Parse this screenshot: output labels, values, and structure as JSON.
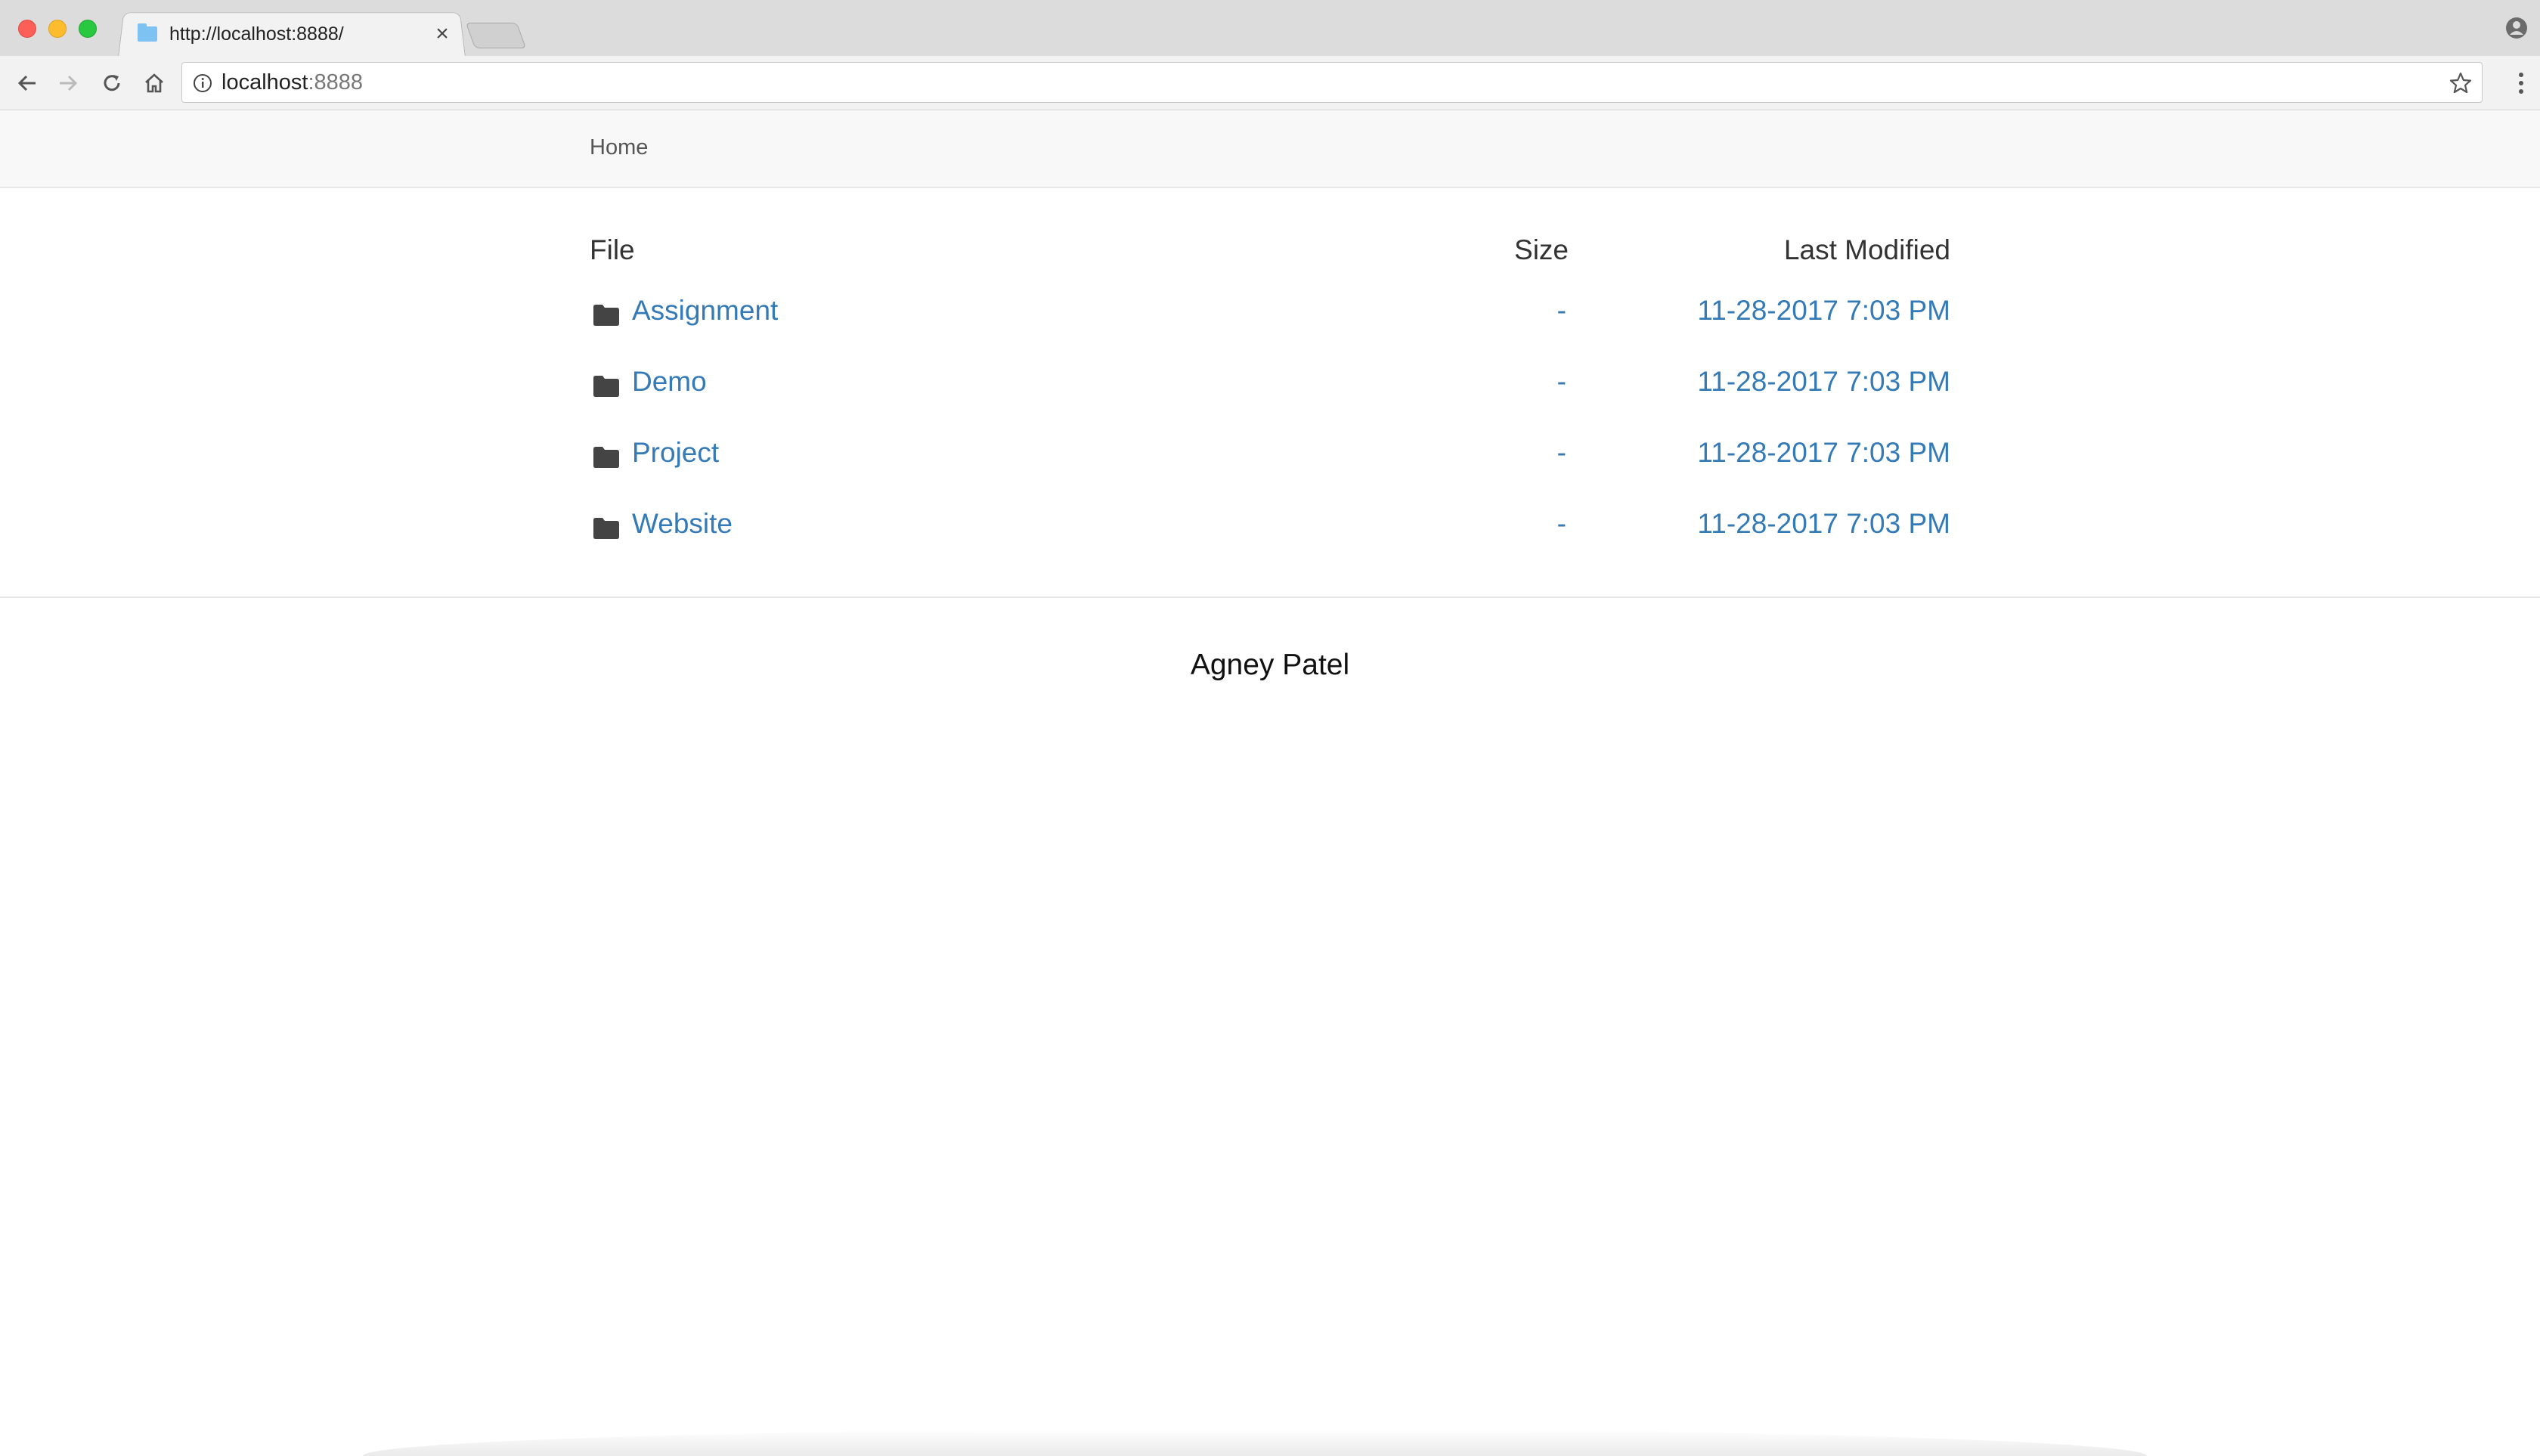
{
  "browser": {
    "tab_title": "http://localhost:8888/",
    "tab_close": "×",
    "url_host": "localhost",
    "url_port": ":8888"
  },
  "page": {
    "breadcrumb": "Home",
    "columns": {
      "file": "File",
      "size": "Size",
      "modified": "Last Modified"
    },
    "rows": [
      {
        "name": "Assignment",
        "size": "-",
        "modified": "11-28-2017 7:03 PM"
      },
      {
        "name": "Demo",
        "size": "-",
        "modified": "11-28-2017 7:03 PM"
      },
      {
        "name": "Project",
        "size": "-",
        "modified": "11-28-2017 7:03 PM"
      },
      {
        "name": "Website",
        "size": "-",
        "modified": "11-28-2017 7:03 PM"
      }
    ],
    "footer": "Agney Patel"
  },
  "icons": {
    "folder": "folder-icon",
    "back": "back-arrow-icon",
    "forward": "forward-arrow-icon",
    "reload": "reload-icon",
    "home": "home-icon",
    "info": "info-icon",
    "star": "star-icon",
    "menu": "kebab-menu-icon",
    "profile": "profile-icon"
  },
  "colors": {
    "link": "#337ab7",
    "navbar_bg": "#f8f8f8",
    "tab_favicon": "#7ec2f4"
  }
}
